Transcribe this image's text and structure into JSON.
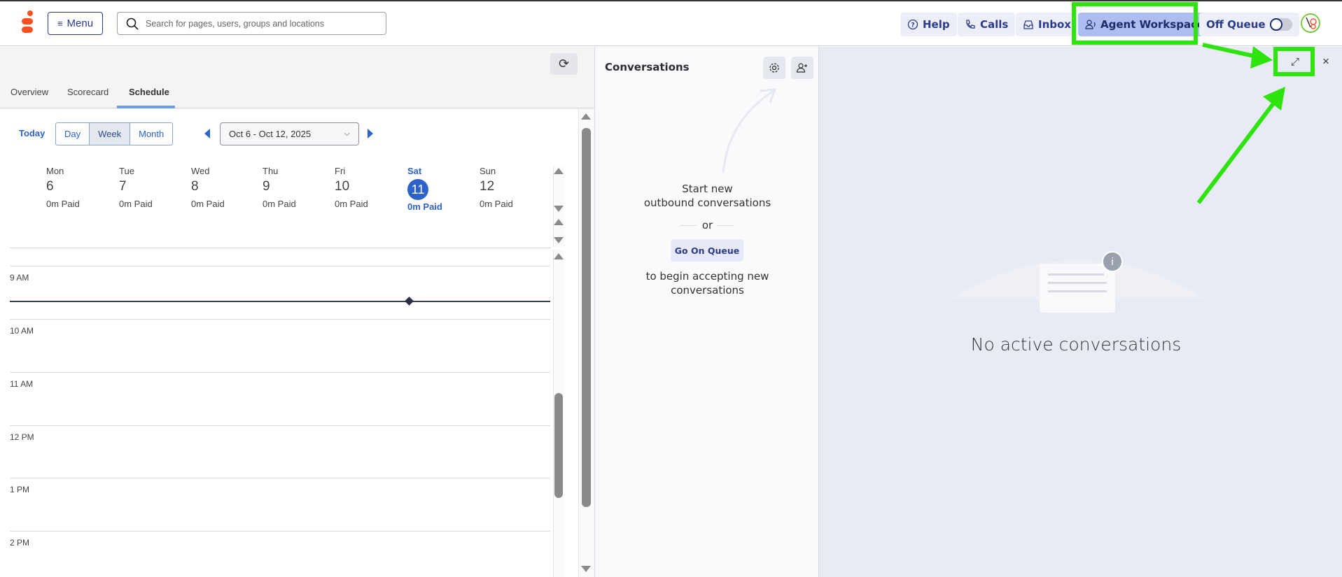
{
  "header": {
    "menu_label": "Menu",
    "search_placeholder": "Search for pages, users, groups and locations",
    "help": "Help",
    "calls": "Calls",
    "inbox": "Inbox",
    "agent_workspace": "Agent Workspace",
    "off_queue": "Off Queue"
  },
  "left": {
    "tabs": [
      "Overview",
      "Scorecard",
      "Schedule"
    ],
    "active_tab": "Schedule",
    "today": "Today",
    "views": [
      "Day",
      "Week",
      "Month"
    ],
    "active_view": "Week",
    "date_range": "Oct 6 - Oct 12, 2025",
    "days": [
      {
        "name": "Mon",
        "num": "6",
        "paid": "0m Paid"
      },
      {
        "name": "Tue",
        "num": "7",
        "paid": "0m Paid"
      },
      {
        "name": "Wed",
        "num": "8",
        "paid": "0m Paid"
      },
      {
        "name": "Thu",
        "num": "9",
        "paid": "0m Paid"
      },
      {
        "name": "Fri",
        "num": "10",
        "paid": "0m Paid"
      },
      {
        "name": "Sat",
        "num": "11",
        "paid": "0m Paid"
      },
      {
        "name": "Sun",
        "num": "12",
        "paid": "0m Paid"
      }
    ],
    "hours": [
      "9 AM",
      "10 AM",
      "11 AM",
      "12 PM",
      "1 PM",
      "2 PM"
    ]
  },
  "conversations": {
    "title": "Conversations",
    "start_line1": "Start new",
    "start_line2": "outbound conversations",
    "or": "or",
    "go_on_queue": "Go On Queue",
    "accept_line1": "to begin accepting new",
    "accept_line2": "conversations"
  },
  "workspace": {
    "empty": "No active conversations"
  },
  "colors": {
    "accent": "#2d62c8",
    "highlight": "#2fe30f",
    "brand": "#ff4f1f"
  }
}
